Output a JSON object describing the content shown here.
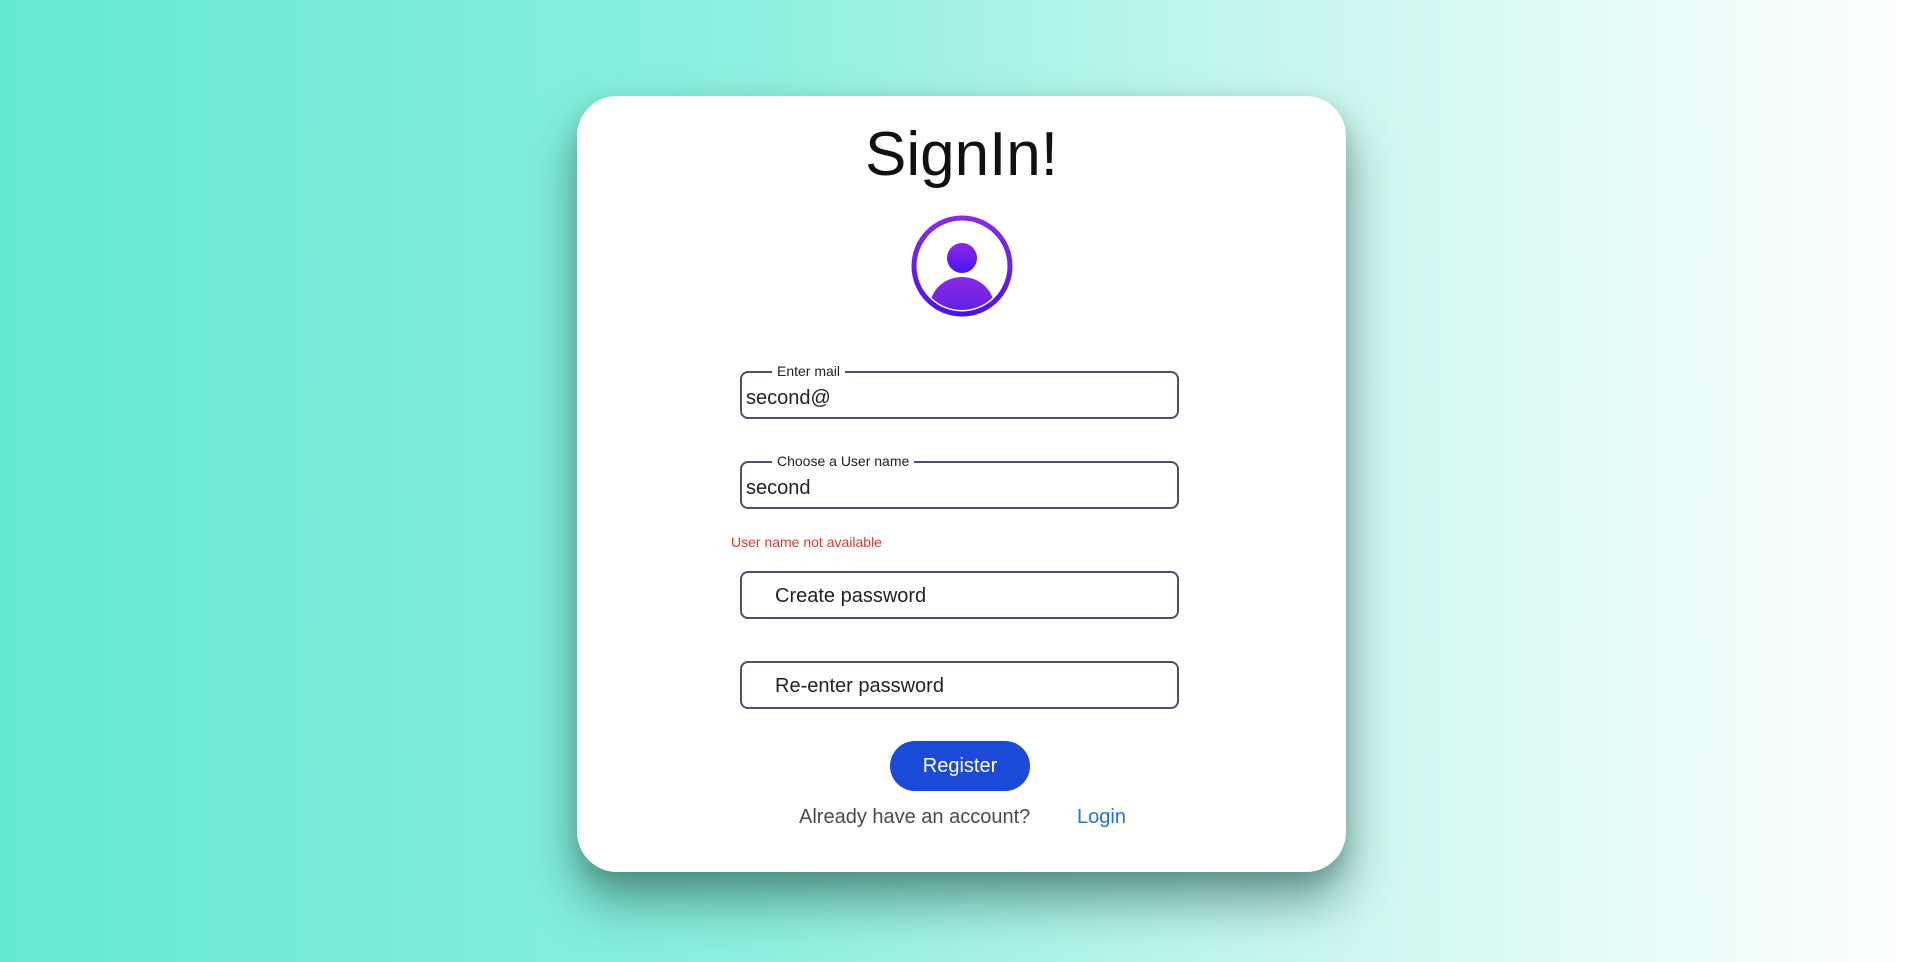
{
  "form": {
    "title": "SignIn!",
    "avatar_icon": "user-avatar-icon",
    "accent_color": "#7a1ff0",
    "email": {
      "legend": "Enter mail",
      "value": "second@"
    },
    "username": {
      "legend": "Choose a User name",
      "value": "second",
      "error": "User name not available"
    },
    "password": {
      "placeholder": "Create password"
    },
    "confirm_password": {
      "placeholder": "Re-enter password"
    },
    "register_label": "Register",
    "register_color": "#1a4ad6",
    "account_prompt": "Already have an account?",
    "login_label": "Login"
  }
}
